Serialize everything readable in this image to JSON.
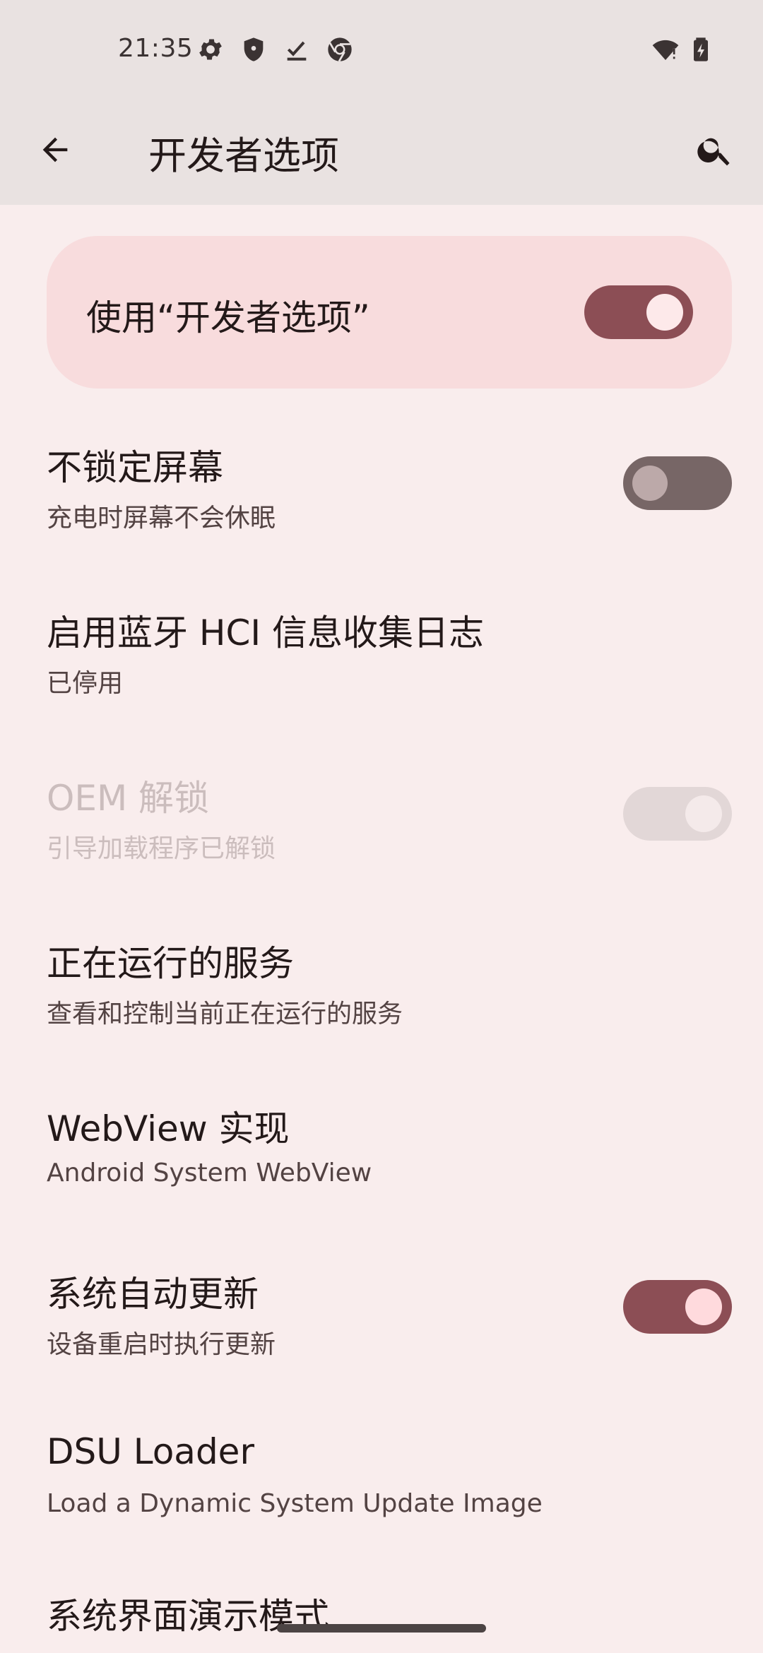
{
  "status_bar": {
    "time": "21:35",
    "icons": [
      "gear-icon",
      "shield-icon",
      "download-done-icon",
      "chrome-icon",
      "wifi-icon",
      "battery-charging-icon"
    ]
  },
  "app_bar": {
    "title": "开发者选项"
  },
  "master_toggle": {
    "label": "使用“开发者选项”",
    "checked": true
  },
  "settings": [
    {
      "title": "不锁定屏幕",
      "summary": "充电时屏幕不会休眠",
      "toggle": "off"
    },
    {
      "title": "启用蓝牙 HCI 信息收集日志",
      "summary": "已停用"
    },
    {
      "title": "OEM 解锁",
      "summary": "引导加载程序已解锁",
      "toggle": "disabled-on"
    },
    {
      "title": "正在运行的服务",
      "summary": "查看和控制当前正在运行的服务"
    },
    {
      "title": "WebView 实现",
      "summary": "Android System WebView"
    },
    {
      "title": "系统自动更新",
      "summary": "设备重启时执行更新",
      "toggle": "on"
    },
    {
      "title": "DSU Loader",
      "summary": "Load a Dynamic System Update Image"
    },
    {
      "title": "系统界面演示模式"
    }
  ],
  "colors": {
    "background": "#f9eded",
    "bar": "#e9e2e1",
    "card": "#f8dcdd",
    "accent": "#8c4e55"
  }
}
